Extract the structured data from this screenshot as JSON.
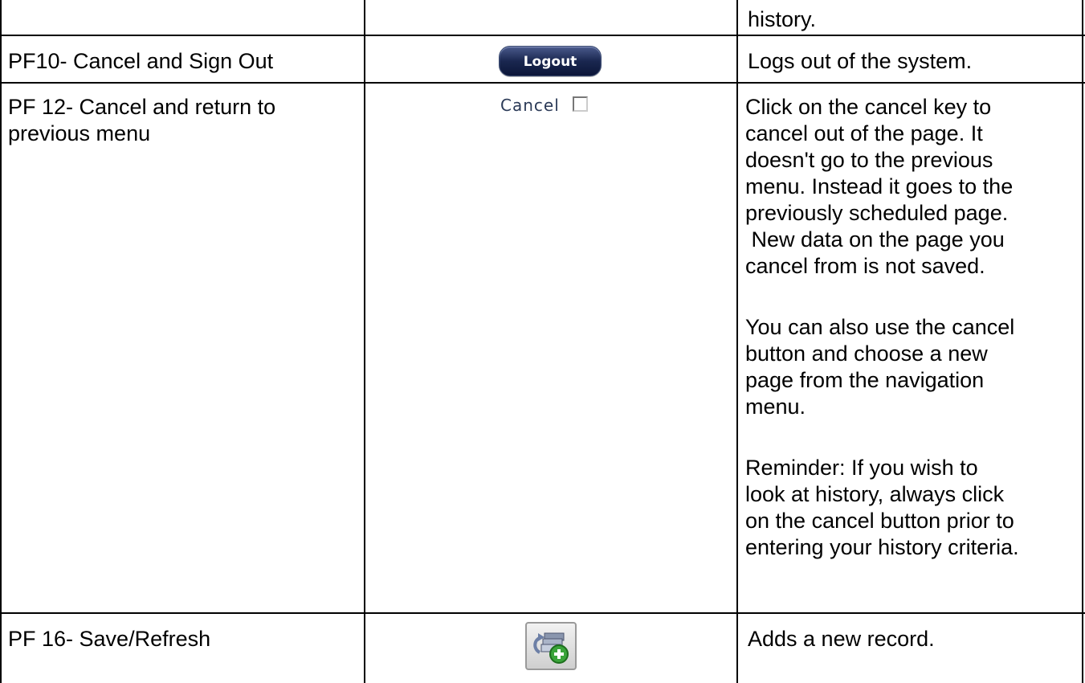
{
  "rows": [
    {
      "key": "",
      "description": [
        "history."
      ]
    },
    {
      "key": [
        "PF10- Cancel and Sign Out"
      ],
      "control": "Logout",
      "description": [
        "Logs out of the system."
      ]
    },
    {
      "key": [
        "PF 12- Cancel and return to",
        "previous menu"
      ],
      "control": "Cancel",
      "description": [
        "Click on the cancel key to",
        "cancel out of the page.  It",
        "doesn't go to the previous",
        "menu.  Instead it goes to the",
        "previously scheduled page.",
        " New data on the page you",
        "cancel from is not saved.",
        "",
        "You can also use the cancel",
        "button and choose a new",
        "page from the navigation",
        "menu.",
        "",
        "Reminder: If you wish to",
        "look at history, always click",
        "on the cancel button prior to",
        "entering your history criteria."
      ]
    },
    {
      "key": [
        "PF 16- Save/Refresh"
      ],
      "control_icon": "save-refresh-icon",
      "description": [
        "Adds a new record."
      ]
    }
  ],
  "colors": {
    "logout_button": "#1a2750",
    "cancel_label": "#2b3a57",
    "icon_green": "#3aa43a"
  }
}
